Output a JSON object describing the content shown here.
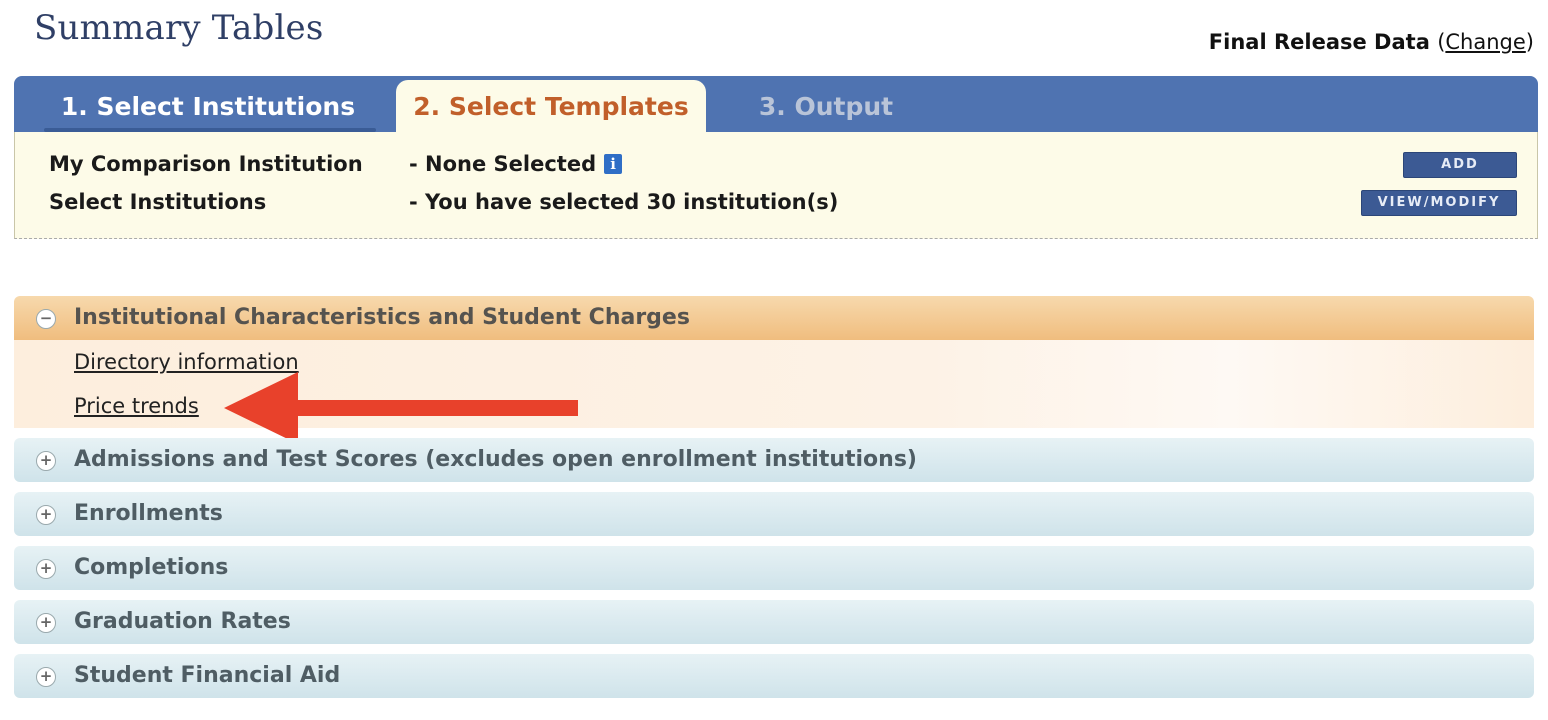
{
  "page_title": "Summary Tables",
  "release": {
    "label": "Final Release Data",
    "open_paren": "(",
    "change_link": "Change",
    "close_paren": ")"
  },
  "tabs": [
    {
      "label": "1. Select Institutions"
    },
    {
      "label": "2. Select Templates"
    },
    {
      "label": "3. Output"
    }
  ],
  "panel": {
    "comparison_label": "My Comparison Institution",
    "comparison_value": "- None Selected",
    "info_icon": "i",
    "select_label": "Select Institutions",
    "select_value": "- You have selected 30 institution(s)",
    "add_button": "ADD",
    "view_button": "VIEW/MODIFY"
  },
  "sections": [
    {
      "icon": "−",
      "title": "Institutional Characteristics and Student Charges",
      "links": [
        "Directory information",
        "Price trends"
      ]
    },
    {
      "icon": "+",
      "title": "Admissions and Test Scores (excludes open enrollment institutions)"
    },
    {
      "icon": "+",
      "title": "Enrollments"
    },
    {
      "icon": "+",
      "title": "Completions"
    },
    {
      "icon": "+",
      "title": "Graduation Rates"
    },
    {
      "icon": "+",
      "title": "Student Financial Aid"
    }
  ],
  "colors": {
    "tab_bar": "#4f73b1",
    "active_tab_text": "#c15f2a",
    "open_section": "#f0bd7e",
    "arrow": "#e8412b"
  }
}
